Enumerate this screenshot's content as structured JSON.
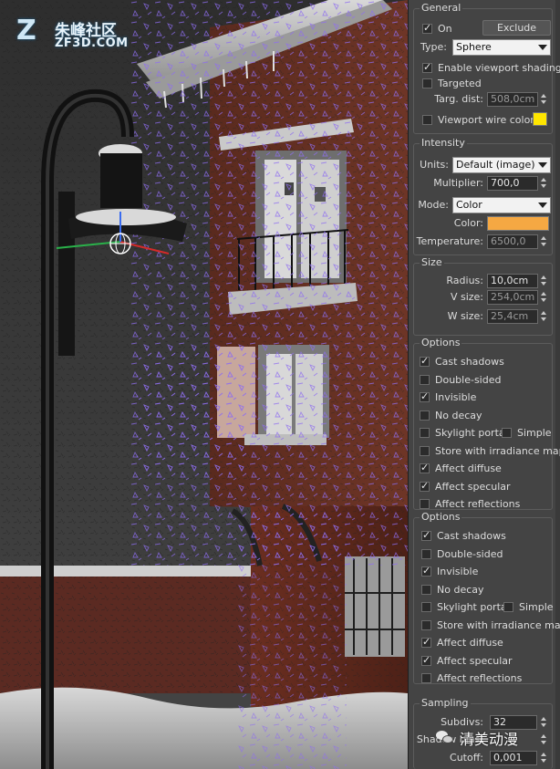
{
  "watermark": {
    "logo_letter": "Z",
    "site_cn": "朱峰社区",
    "site_url": "ZF3D.COM"
  },
  "viewport": {
    "description_icon": "light-gizmo-icon"
  },
  "general": {
    "title": "General",
    "on_label": "On",
    "on_checked": true,
    "exclude_label": "Exclude",
    "type_label": "Type:",
    "type_value": "Sphere",
    "enable_viewport_shading_label": "Enable viewport shading",
    "enable_viewport_shading_checked": true,
    "targeted_label": "Targeted",
    "targeted_checked": false,
    "targ_dist_label": "Targ. dist:",
    "targ_dist_value": "508,0cm",
    "viewport_wire_color_label": "Viewport wire color",
    "viewport_wire_color_checked": false,
    "wire_color": "#ffe600"
  },
  "intensity": {
    "title": "Intensity",
    "units_label": "Units:",
    "units_value": "Default (image)",
    "multiplier_label": "Multiplier:",
    "multiplier_value": "700,0",
    "mode_label": "Mode:",
    "mode_value": "Color",
    "color_label": "Color:",
    "color_value": "#f5a843",
    "temperature_label": "Temperature:",
    "temperature_value": "6500,0"
  },
  "size": {
    "title": "Size",
    "radius_label": "Radius:",
    "radius_value": "10,0cm",
    "vsize_label": "V size:",
    "vsize_value": "254,0cm",
    "wsize_label": "W size:",
    "wsize_value": "25,4cm"
  },
  "options1": {
    "title": "Options",
    "items": [
      {
        "label": "Cast shadows",
        "checked": true
      },
      {
        "label": "Double-sided",
        "checked": false
      },
      {
        "label": "Invisible",
        "checked": true
      },
      {
        "label": "No decay",
        "checked": false
      },
      {
        "label": "Skylight portal",
        "checked": false
      },
      {
        "label": "Store with irradiance map",
        "checked": false
      },
      {
        "label": "Affect diffuse",
        "checked": true
      },
      {
        "label": "Affect specular",
        "checked": true
      },
      {
        "label": "Affect reflections",
        "checked": false
      }
    ],
    "simple_label": "Simple",
    "simple_checked": false
  },
  "options2": {
    "title": "Options",
    "items": [
      {
        "label": "Cast shadows",
        "checked": true
      },
      {
        "label": "Double-sided",
        "checked": false
      },
      {
        "label": "Invisible",
        "checked": true
      },
      {
        "label": "No decay",
        "checked": false
      },
      {
        "label": "Skylight portal",
        "checked": false
      },
      {
        "label": "Store with irradiance map",
        "checked": false
      },
      {
        "label": "Affect diffuse",
        "checked": true
      },
      {
        "label": "Affect specular",
        "checked": true
      },
      {
        "label": "Affect reflections",
        "checked": false
      }
    ],
    "simple_label": "Simple",
    "simple_checked": false
  },
  "sampling": {
    "title": "Sampling",
    "subdivs_label": "Subdivs:",
    "subdivs_value": "32",
    "shadow_bias_label": "Shadow bias:",
    "cutoff_label": "Cutoff:",
    "cutoff_value": "0,001"
  },
  "overlay": {
    "wechat_text": "清美动漫"
  }
}
